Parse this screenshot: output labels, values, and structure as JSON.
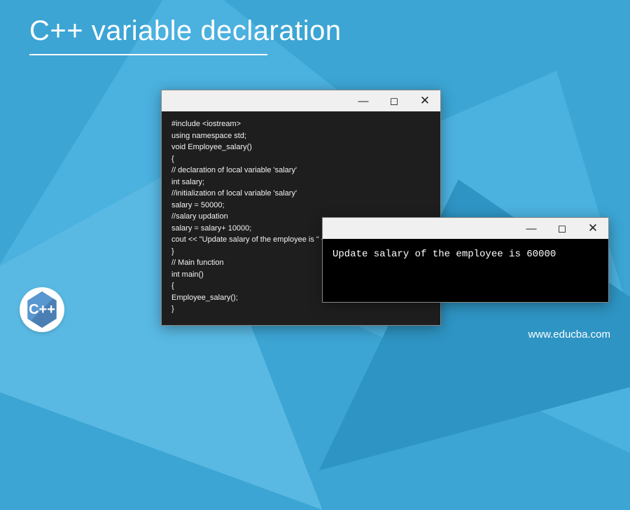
{
  "header": {
    "title": "C++ variable declaration"
  },
  "logo": {
    "text": "C++"
  },
  "footer": {
    "site": "www.educba.com"
  },
  "code_window": {
    "lines": [
      "#include <iostream>",
      "using namespace std;",
      "void Employee_salary()",
      "{",
      "// declaration of local variable 'salary'",
      "int salary;",
      "//initialization of local variable 'salary'",
      "salary = 50000;",
      "//salary updation",
      "salary = salary+ 10000;",
      "cout << \"Update salary of the employee is \" << salary;",
      "}",
      "// Main function",
      "int main()",
      "{",
      "Employee_salary();",
      "}"
    ]
  },
  "output_window": {
    "text": "Update salary of the employee is 60000"
  },
  "window_controls": {
    "minimize": "—",
    "maximize": "◻",
    "close": "✕"
  }
}
